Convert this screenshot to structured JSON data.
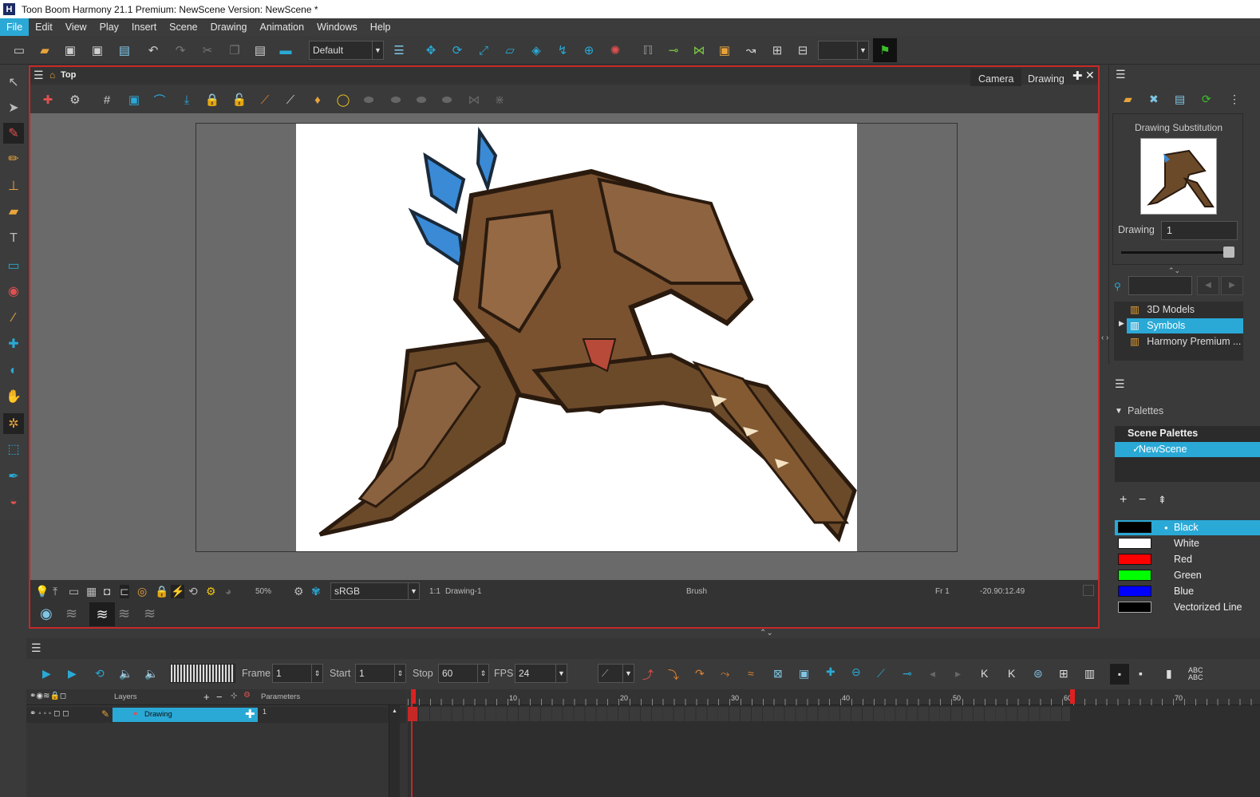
{
  "window": {
    "title": "Toon Boom Harmony 21.1 Premium: NewScene Version: NewScene *",
    "logo": "H"
  },
  "menu": [
    "File",
    "Edit",
    "View",
    "Play",
    "Insert",
    "Scene",
    "Drawing",
    "Animation",
    "Windows",
    "Help"
  ],
  "toolbar": {
    "workspace": "Default"
  },
  "view": {
    "breadcrumb": "Top",
    "tabs": [
      "Camera",
      "Drawing"
    ],
    "zoom": "50%",
    "colorspace": "sRGB",
    "ratio": "1:1",
    "drawing_name": "Drawing-1",
    "tool": "Brush",
    "frame": "Fr 1",
    "coords": "-20.90:12.49"
  },
  "library": {
    "substitution_title": "Drawing Substitution",
    "drawing_label": "Drawing",
    "drawing_value": "1",
    "tree": [
      "3D Models",
      "Symbols",
      "Harmony Premium ..."
    ]
  },
  "palettes": {
    "title": "Palettes",
    "scene_palettes": "Scene Palettes",
    "palette_name": "NewScene",
    "colors": [
      {
        "name": "Black",
        "hex": "#000000"
      },
      {
        "name": "White",
        "hex": "#ffffff"
      },
      {
        "name": "Red",
        "hex": "#ff0000"
      },
      {
        "name": "Green",
        "hex": "#00ff00"
      },
      {
        "name": "Blue",
        "hex": "#0000ff"
      },
      {
        "name": "Vectorized Line",
        "hex": "#000000"
      }
    ]
  },
  "timeline": {
    "frame_label": "Frame",
    "frame_value": "1",
    "start_label": "Start",
    "start_value": "1",
    "stop_label": "Stop",
    "stop_value": "60",
    "fps_label": "FPS",
    "fps_value": "24",
    "layers_header": "Layers",
    "params_header": "Parameters",
    "layer_name": "Drawing",
    "layer_frame": "1",
    "ruler": [
      "10",
      "20",
      "30",
      "40",
      "50",
      "60",
      "70"
    ]
  },
  "accent": "#2aa9d6"
}
